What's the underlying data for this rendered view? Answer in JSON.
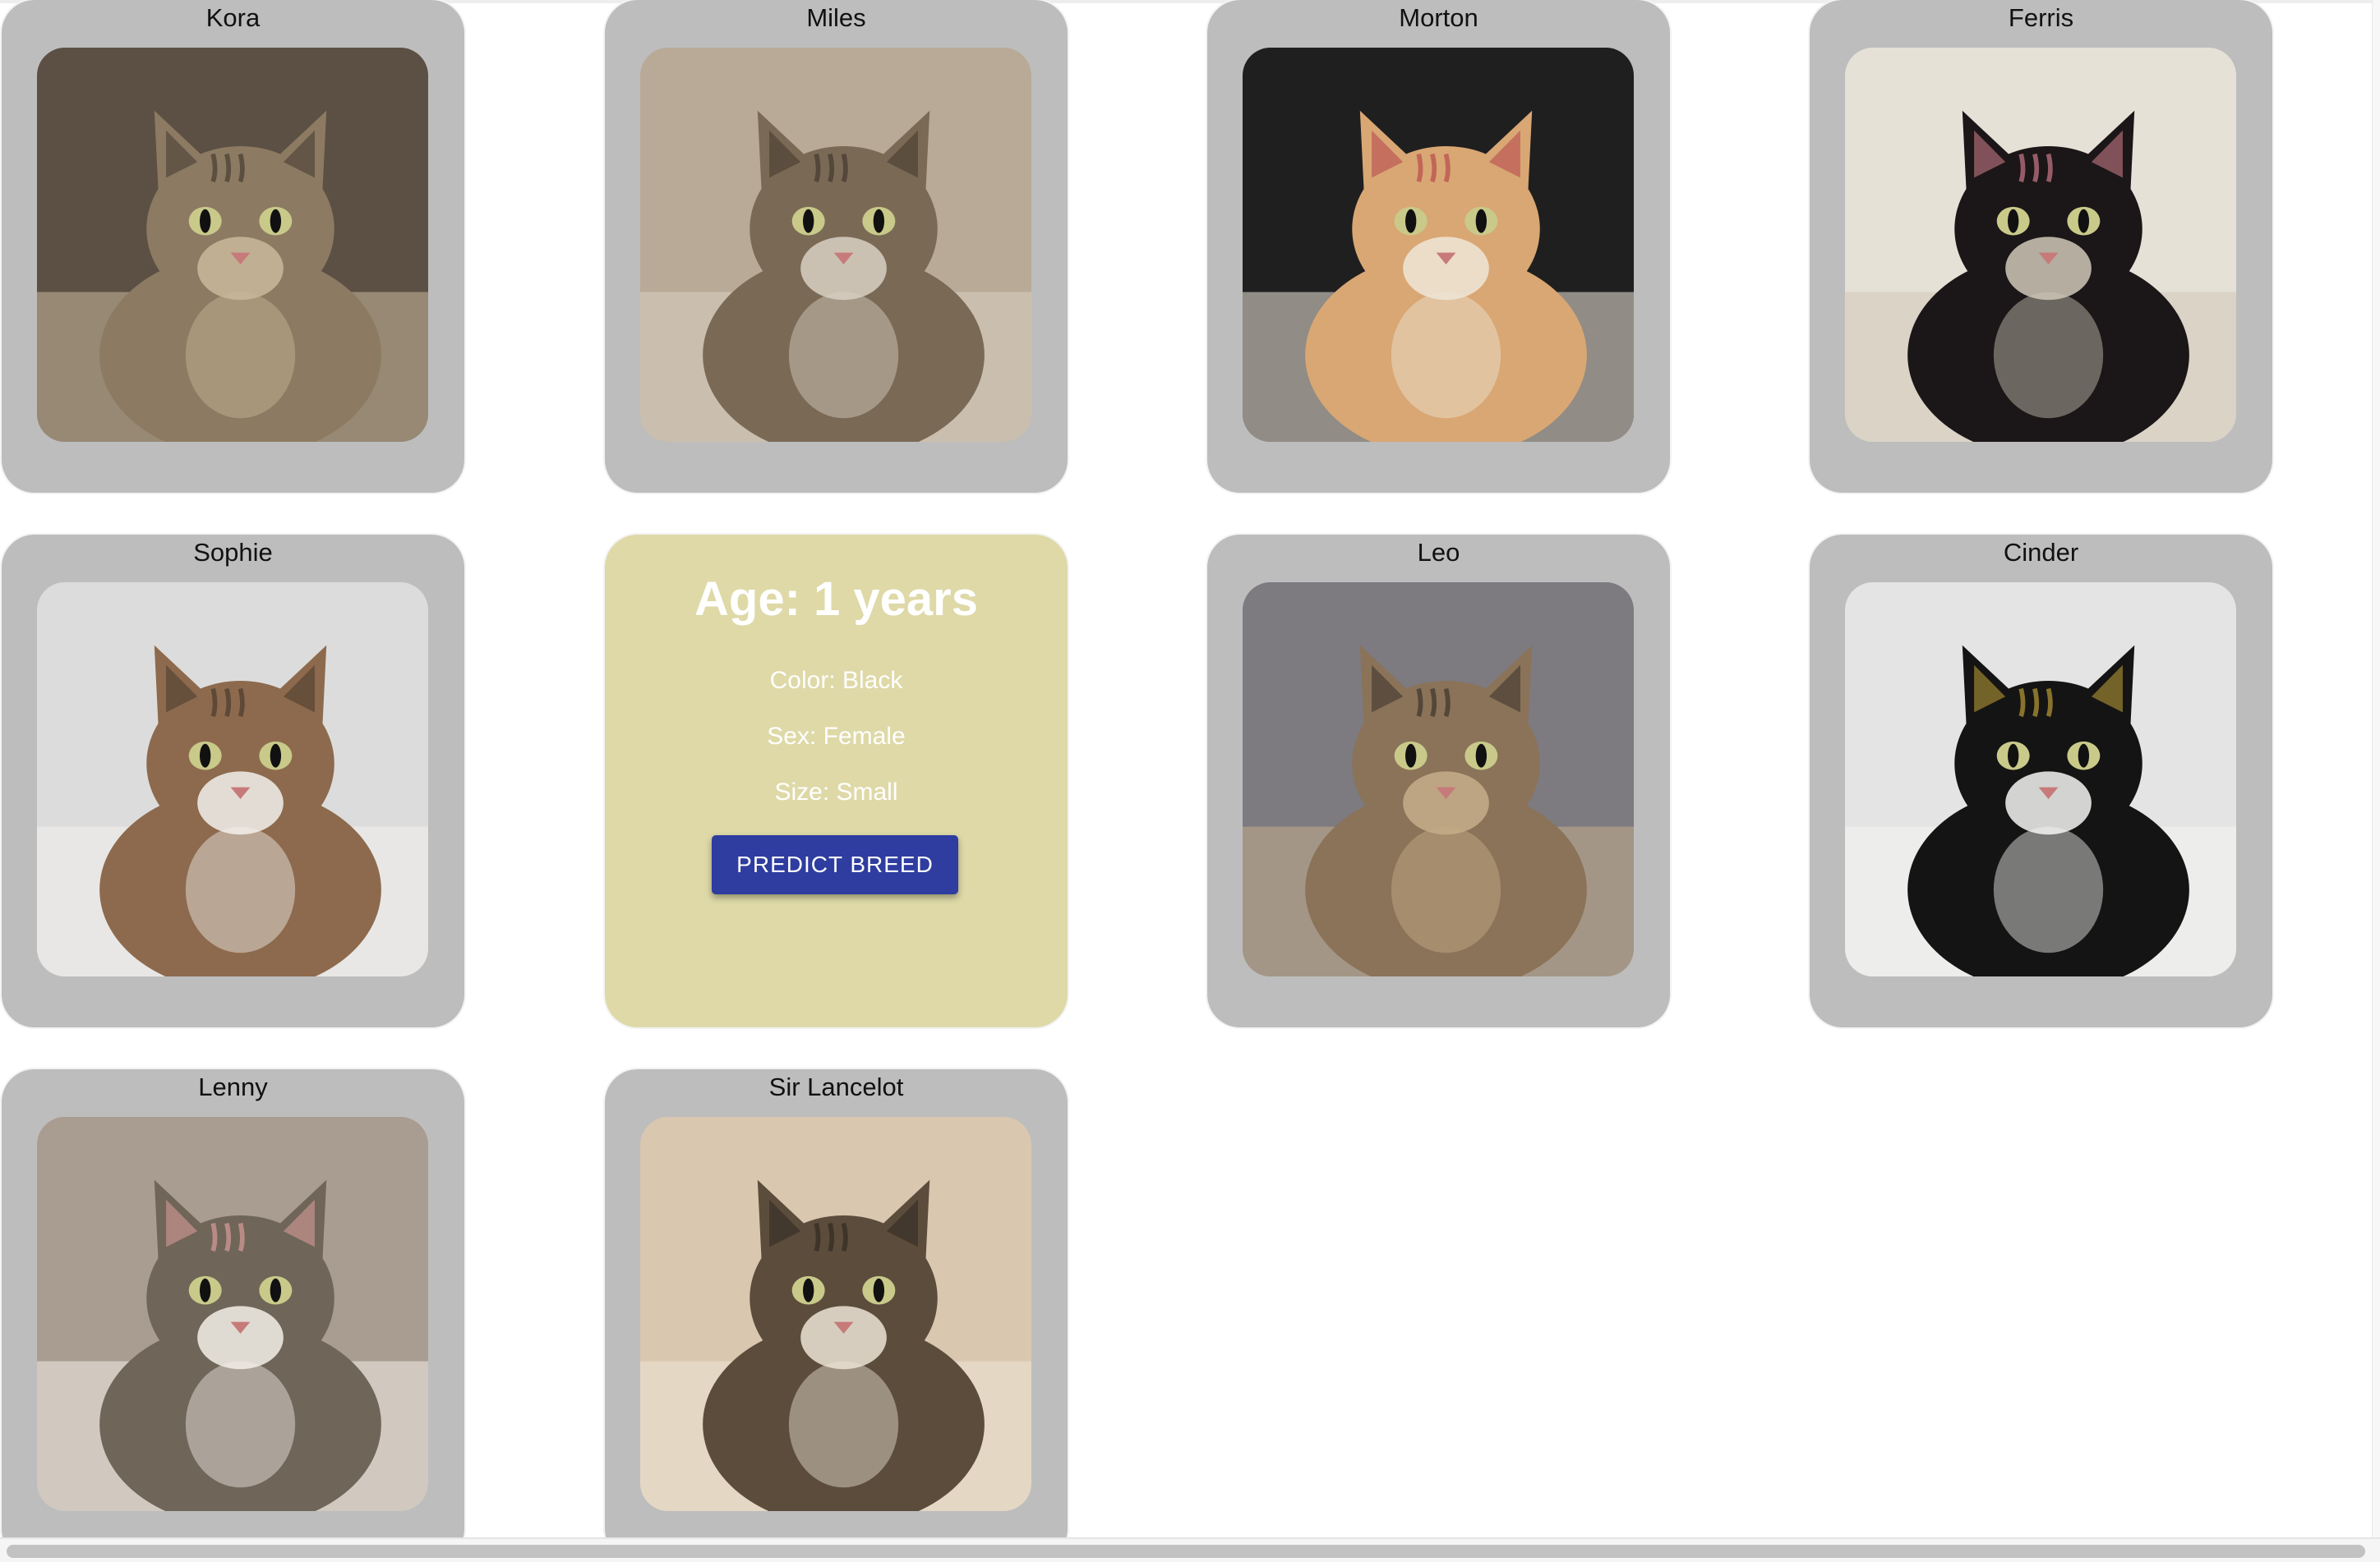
{
  "cats": [
    {
      "name": "Kora",
      "fur": "long-haired brown tabby",
      "palette": [
        "#5b5043",
        "#8c7a62",
        "#c9b89c",
        "#3a3229"
      ]
    },
    {
      "name": "Miles",
      "fur": "brown tabby",
      "palette": [
        "#b8aa97",
        "#7a6a55",
        "#d9d0c3",
        "#3b3128"
      ]
    },
    {
      "name": "Morton",
      "fur": "orange tabby",
      "palette": [
        "#1f1f1f",
        "#d9a774",
        "#eee6d8",
        "#b23a48"
      ]
    },
    {
      "name": "Ferris",
      "fur": "black",
      "palette": [
        "#e6e1d6",
        "#1b1617",
        "#cfc8b9",
        "#e88c9c"
      ]
    },
    {
      "name": "Sophie",
      "fur": "calico",
      "palette": [
        "#dcdcdc",
        "#8d6a4d",
        "#f2f0ec",
        "#3f3329"
      ]
    },
    {
      "name": "Leo",
      "fur": "brown tabby",
      "palette": [
        "#7d7a80",
        "#8a7358",
        "#c5ad8a",
        "#2f2a25"
      ]
    },
    {
      "name": "Cinder",
      "fur": "tuxedo",
      "palette": [
        "#e4e4e4",
        "#141414",
        "#f4f4f2",
        "#d4b23b"
      ]
    },
    {
      "name": "Lenny",
      "fur": "tabby and white",
      "palette": [
        "#a99c90",
        "#6f6558",
        "#f3eee8",
        "#e9a5a6"
      ]
    },
    {
      "name": "Sir Lancelot",
      "fur": "brown tabby",
      "palette": [
        "#d9c7af",
        "#5c4c3c",
        "#ece4d5",
        "#2a241d"
      ]
    }
  ],
  "info_card": {
    "age": "Age: 1 years",
    "color": "Color: Black",
    "sex": "Sex: Female",
    "size": "Size: Small",
    "button_label": "PREDICT BREED",
    "background_color": "#ded9a7",
    "button_color": "#2e3d9f"
  },
  "colors": {
    "card_background": "#bdbdbd",
    "page_background": "#ffffff"
  }
}
